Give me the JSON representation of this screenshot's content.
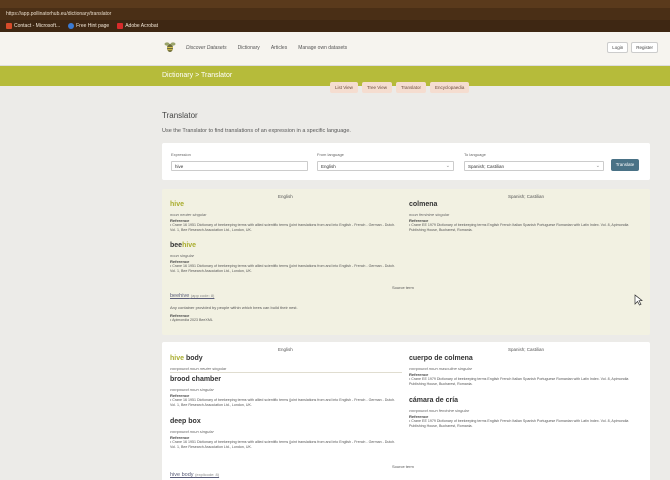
{
  "browser": {
    "url": "https://app.pollinatorhub.eu/dictionary/translator",
    "bookmarks": [
      {
        "label": "Contact - Microsoft...",
        "icon": "office-icon",
        "color": "#d64b2a"
      },
      {
        "label": "Free Hint page",
        "icon": "globe-icon",
        "color": "#3a7bd5"
      },
      {
        "label": "Adobe Acrobat",
        "icon": "acrobat-icon",
        "color": "#d72b2b"
      }
    ]
  },
  "nav": {
    "links": [
      "Discover Datasets",
      "Dictionary",
      "Articles",
      "Manage own datasets"
    ],
    "login": "Login",
    "register": "Register"
  },
  "titlebar": "Dictionary > Translator",
  "tabs": [
    "List View",
    "Tree View",
    "Translator",
    "Encyclopaedia"
  ],
  "page": {
    "title": "Translator",
    "description": "Use the Translator to find translations of an expression in a specific language."
  },
  "form": {
    "expression_label": "Expression",
    "expression_value": "hive",
    "from_label": "From language",
    "from_value": "English",
    "to_label": "To language",
    "to_value": "Spanish; Castilian",
    "translate": "Translate"
  },
  "result1": {
    "left_head": "English",
    "right_head": "Spanish; Castilian",
    "hive_term": "hive",
    "hive_meta": "noun neuter singular",
    "reference_label": "Reference",
    "hive_ref": "Crane 16 1951 Dictionary of beekeeping terms with allied scientific terms (joint translations from and into English - French - German - Dutch. Vol. 1, Bee Research Association Ltd., London, UK.",
    "beehive_prefix": "bee",
    "beehive_suffix": "hive",
    "beehive_meta": "noun singular",
    "beehive_ref": "Crane 16 1951 Dictionary of beekeeping terms with allied scientific terms (joint translations from and into English - French - German - Dutch. Vol. 1, Bee Research Association Ltd., London, UK.",
    "colmena_term": "colmena",
    "colmena_meta": "noun feminine singular",
    "colmena_ref": "Crane EE 1979 Dictionary of beekeeping terms English French Italian Spanish Portuguese Romanian with Latin Index. Vol. 8, Apimondia Publishing House, Bucharest, Romania.",
    "source_label": "Source term",
    "source_link": "beehive",
    "source_sub": "(app code: 8)",
    "source_def": "Any container provided by people within which bees can build their nest.",
    "source_ref": "Apimondia 2023 BeeXML"
  },
  "result2": {
    "left_head": "English",
    "right_head": "Spanish; Castilian",
    "t1_prefix": "hive",
    "t1_suffix": " body",
    "t1_meta": "compound noun neuter singular",
    "t2": "brood chamber",
    "t2_meta": "compound noun singular",
    "reference_label": "Reference",
    "t2_ref": "Crane 16 1951 Dictionary of beekeeping terms with allied scientific terms (joint translations from and into English - French - German - Dutch. Vol. 1, Bee Research Association Ltd., London, UK.",
    "t3": "deep box",
    "t3_meta": "compound noun singular",
    "t3_ref": "Crane 16 1951 Dictionary of beekeeping terms with allied scientific terms (joint translations from and into English - French - German - Dutch. Vol. 1, Bee Research Association Ltd., London, UK.",
    "r1": "cuerpo de colmena",
    "r1_meta": "compound noun masculine singular",
    "r1_ref": "Crane EE 1979 Dictionary of beekeeping terms English French Italian Spanish Portuguese Romanian with Latin Index. Vol. 8, Apimondia Publishing House, Bucharest, Romania.",
    "r2": "cámara de cría",
    "r2_meta": "compound noun feminine singular",
    "r2_ref": "Crane EE 1979 Dictionary of beekeeping terms English French Italian Spanish Portuguese Romanian with Latin Index. Vol. 8, Apimondia Publishing House, Bucharest, Romania.",
    "source_label": "Source term",
    "source_link": "hive body",
    "source_sub": "(explicode: 8)"
  }
}
